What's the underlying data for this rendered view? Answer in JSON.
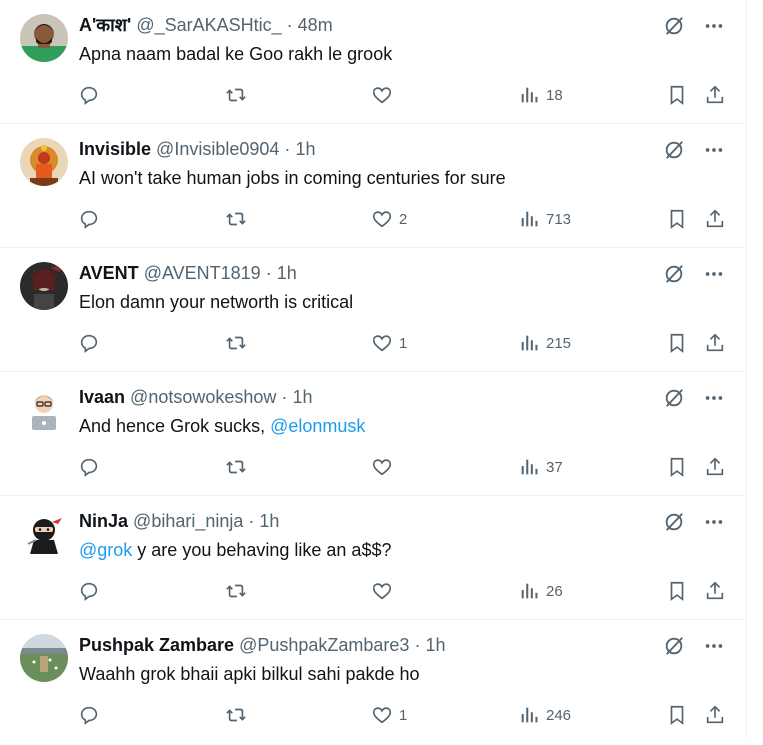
{
  "tweets": [
    {
      "name": "A'काश'",
      "handle": "@_SarAKASHtic_",
      "time": "48m",
      "text": "Apna naam badal ke Goo rakh le grook",
      "mention": "",
      "likes": "",
      "views": "18",
      "avatar": "person-green-shirt"
    },
    {
      "name": "Invisible",
      "handle": "@Invisible0904",
      "time": "1h",
      "text": "AI won't take human jobs in coming centuries for sure",
      "mention": "",
      "likes": "2",
      "views": "713",
      "avatar": "deity-idol"
    },
    {
      "name": "AVENT",
      "handle": "@AVENT1819",
      "time": "1h",
      "text": "Elon damn your networth is critical",
      "mention": "",
      "likes": "1",
      "views": "215",
      "avatar": "dark-character"
    },
    {
      "name": "Ivaan",
      "handle": "@notsowokeshow",
      "time": "1h",
      "text": "And hence Grok sucks, ",
      "mention": "@elonmusk",
      "likes": "",
      "views": "37",
      "avatar": "cartoon-laptop"
    },
    {
      "name": "NinJa",
      "handle": "@bihari_ninja",
      "time": "1h",
      "text": " y are you behaving like an a$$?",
      "mention": "@grok",
      "mention_first": true,
      "likes": "",
      "views": "26",
      "avatar": "ninja"
    },
    {
      "name": "Pushpak Zambare",
      "handle": "@PushpakZambare3",
      "time": "1h",
      "text": "Waahh grok bhaii apki bilkul sahi pakde ho",
      "mention": "",
      "likes": "1",
      "views": "246",
      "avatar": "cricket-field"
    }
  ],
  "separator": "·",
  "colors": {
    "text": "#0f1419",
    "muted": "#536471",
    "link": "#1d9bf0",
    "border": "#eff3f4"
  }
}
